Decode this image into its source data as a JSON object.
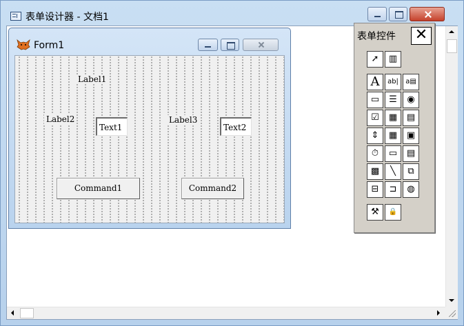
{
  "window": {
    "title": "表单设计器 - 文档1"
  },
  "form": {
    "title": "Form1",
    "controls": {
      "label1": "Label1",
      "label2": "Label2",
      "label3": "Label3",
      "text1": "Text1",
      "text2": "Text2",
      "command1": "Command1",
      "command2": "Command2"
    }
  },
  "toolbox": {
    "title": "表单控件",
    "close_glyph": "✕",
    "tools": [
      {
        "name": "select-objects",
        "glyph": "➚"
      },
      {
        "name": "view-classes",
        "glyph": "▥"
      },
      {
        "name": "label",
        "glyph": "A"
      },
      {
        "name": "text-box",
        "glyph": "ab|"
      },
      {
        "name": "edit-box",
        "glyph": "a▤"
      },
      {
        "name": "command-button",
        "glyph": "▭"
      },
      {
        "name": "command-group",
        "glyph": "☰"
      },
      {
        "name": "option-group",
        "glyph": "◉"
      },
      {
        "name": "check-box",
        "glyph": "☑"
      },
      {
        "name": "combo-box",
        "glyph": "▦"
      },
      {
        "name": "list-box",
        "glyph": "▤"
      },
      {
        "name": "spinner",
        "glyph": "⇕"
      },
      {
        "name": "grid",
        "glyph": "▦"
      },
      {
        "name": "image",
        "glyph": "▣"
      },
      {
        "name": "timer",
        "glyph": "⏱"
      },
      {
        "name": "page-frame",
        "glyph": "▭"
      },
      {
        "name": "ole-container",
        "glyph": "▤"
      },
      {
        "name": "ole-bound",
        "glyph": "▩"
      },
      {
        "name": "line",
        "glyph": "╲"
      },
      {
        "name": "shape",
        "glyph": "⧉"
      },
      {
        "name": "container",
        "glyph": "⊟"
      },
      {
        "name": "separator",
        "glyph": "⊐"
      },
      {
        "name": "hyperlink",
        "glyph": "◍"
      },
      {
        "name": "builder-lock",
        "glyph": "⚒"
      },
      {
        "name": "lock",
        "glyph": "🔒"
      }
    ]
  }
}
